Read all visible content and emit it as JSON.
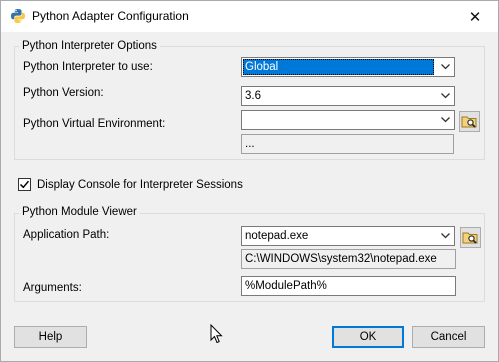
{
  "window": {
    "title": "Python Adapter Configuration",
    "close_glyph": "✕"
  },
  "interpreter_group": {
    "title": "Python Interpreter Options",
    "interpreter_label": "Python Interpreter to use:",
    "interpreter_value": "Global",
    "version_label": "Python Version:",
    "version_value": "3.6",
    "venv_label": "Python Virtual Environment:",
    "venv_value": "",
    "venv_path_value": "..."
  },
  "console_checkbox": {
    "label": "Display Console for Interpreter Sessions",
    "checked": true
  },
  "module_viewer_group": {
    "title": "Python Module Viewer",
    "app_path_label": "Application Path:",
    "app_path_value": "notepad.exe",
    "app_path_resolved": "C:\\WINDOWS\\system32\\notepad.exe",
    "arguments_label": "Arguments:",
    "arguments_value": "%ModulePath%"
  },
  "buttons": {
    "help": "Help",
    "ok": "OK",
    "cancel": "Cancel"
  },
  "colors": {
    "selection": "#0078d7",
    "window_bg": "#f0f0f0"
  },
  "icons": [
    "python-logo-icon",
    "close-icon",
    "chevron-down-icon",
    "folder-browse-icon",
    "checkmark-icon",
    "mouse-cursor-icon"
  ]
}
